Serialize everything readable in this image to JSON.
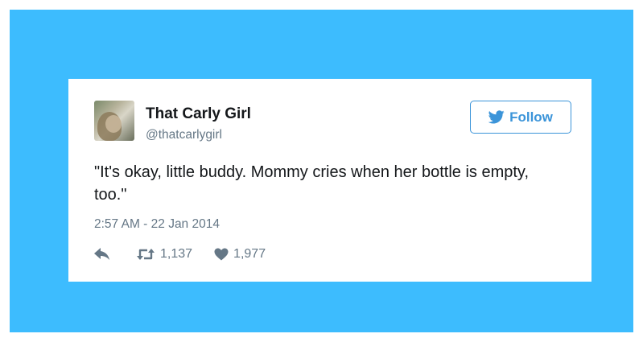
{
  "tweet": {
    "author": {
      "display_name": "That Carly Girl",
      "handle": "@thatcarlygirl"
    },
    "follow_button": {
      "label": "Follow"
    },
    "text": "\"It's okay, little buddy. Mommy cries when her bottle is empty, too.\"",
    "timestamp": "2:57 AM - 22 Jan 2014",
    "actions": {
      "retweets": "1,137",
      "likes": "1,977"
    }
  },
  "colors": {
    "frame_background": "#3dbcfe",
    "accent": "#3b94d9",
    "text_primary": "#14171a",
    "text_secondary": "#657786"
  },
  "icons": {
    "follow": "bird-icon",
    "reply": "reply-icon",
    "retweet": "retweet-icon",
    "like": "heart-icon"
  }
}
